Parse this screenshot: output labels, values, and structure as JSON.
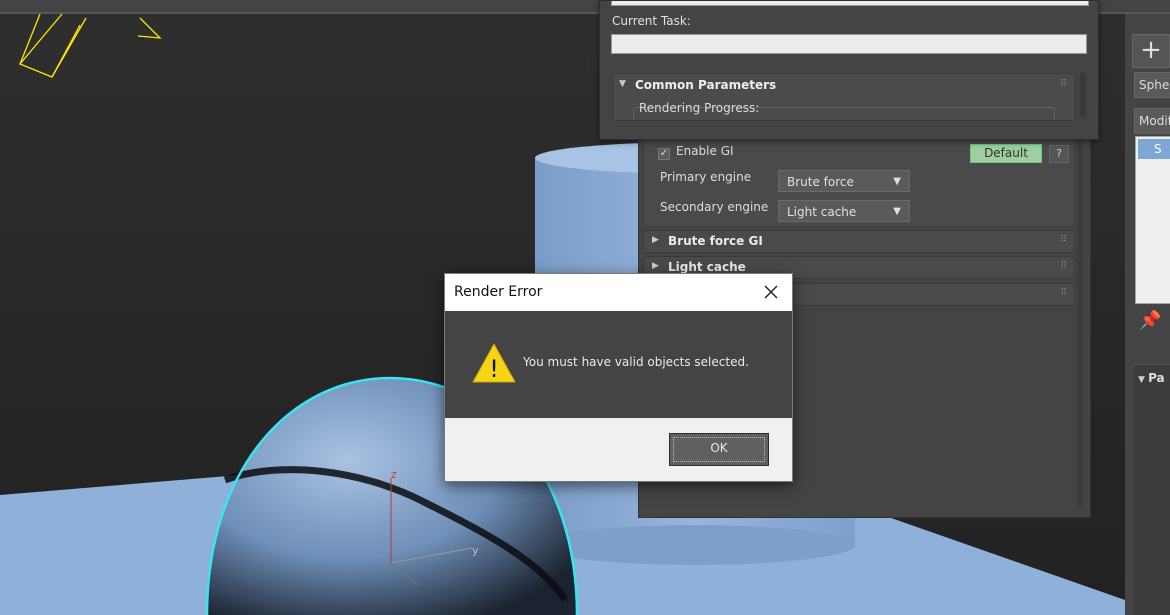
{
  "render_progress": {
    "current_task_label": "Current Task:",
    "common_parameters_title": "Common Parameters",
    "rendering_progress_label": "Rendering Progress:"
  },
  "render_setup": {
    "enable_gi_label": "Enable GI",
    "enable_gi_checked": true,
    "default_button": "Default",
    "help_button": "?",
    "primary_engine_label": "Primary engine",
    "primary_engine_value": "Brute force",
    "secondary_engine_label": "Secondary engine",
    "secondary_engine_value": "Light cache",
    "rollouts": [
      "Brute force GI",
      "Light cache",
      ""
    ]
  },
  "command_panel": {
    "create_button": "+",
    "object_name": "Sphere",
    "modifier_list": "Modifier List",
    "stack_selected": "S",
    "params_rollout": "Pa"
  },
  "viewport": {
    "axis_z": "z",
    "axis_y": "y",
    "axis_x": "x"
  },
  "dialog": {
    "title": "Render Error",
    "message": "You must have valid objects selected.",
    "ok_button": "OK",
    "warning_glyph": "!"
  },
  "colors": {
    "selection_outline": "#37e6f0",
    "geometry": "#8fb0d8",
    "camera_wire": "#ffe600",
    "default_button": "#9fcf9f"
  }
}
